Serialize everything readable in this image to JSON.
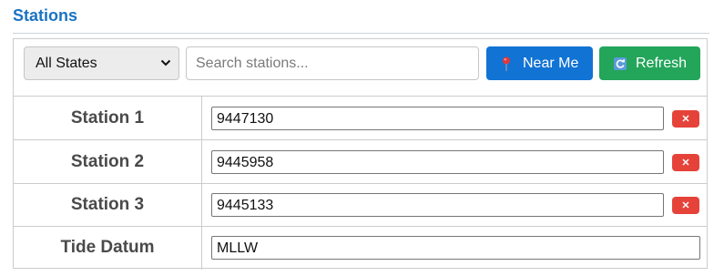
{
  "section": {
    "title": "Stations"
  },
  "toolbar": {
    "state_select_value": "All States",
    "search_placeholder": "Search stations...",
    "near_me_label": "Near Me",
    "near_me_icon": "map-pin-icon",
    "refresh_label": "Refresh",
    "refresh_icon": "refresh-icon"
  },
  "rows": [
    {
      "label": "Station 1",
      "value": "9447130",
      "removable": true
    },
    {
      "label": "Station 2",
      "value": "9445958",
      "removable": true
    },
    {
      "label": "Station 3",
      "value": "9445133",
      "removable": true
    },
    {
      "label": "Tide Datum",
      "value": "MLLW",
      "removable": false
    }
  ],
  "colors": {
    "title": "#1a73c4",
    "near_me_button": "#1173d4",
    "refresh_button": "#23a55a",
    "remove_button": "#e5433a"
  }
}
